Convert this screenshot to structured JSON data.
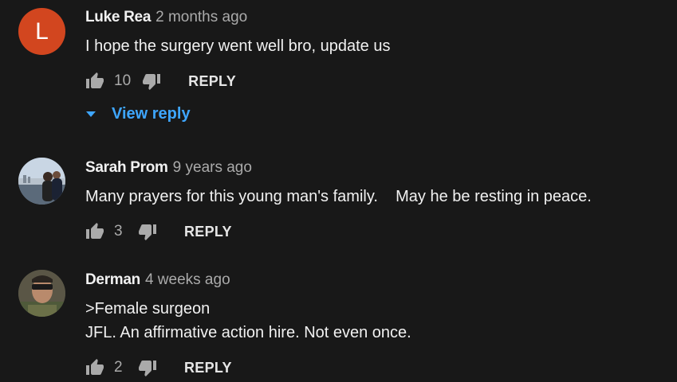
{
  "comments": [
    {
      "author": "Luke Rea",
      "time": "2 months ago",
      "avatar_letter": "L",
      "text": "I hope the surgery went well bro, update us",
      "likes": "10",
      "reply_label": "REPLY",
      "view_replies_label": "View reply"
    },
    {
      "author": "Sarah Prom",
      "time": "9 years ago",
      "text": "Many prayers for this young man's family.    May he be resting in peace.",
      "likes": "3",
      "reply_label": "REPLY"
    },
    {
      "author": "Derman",
      "time": "4 weeks ago",
      "text_lines": [
        ">Female surgeon",
        "JFL. An affirmative action hire. Not even once."
      ],
      "likes": "2",
      "reply_label": "REPLY"
    }
  ],
  "colors": {
    "background": "#181818",
    "link_blue": "#3ea6ff",
    "avatar_orange": "#d2461f",
    "secondary_text": "#aaaaaa"
  },
  "icons": [
    "thumbs-up-icon",
    "thumbs-down-icon",
    "caret-down-icon"
  ]
}
